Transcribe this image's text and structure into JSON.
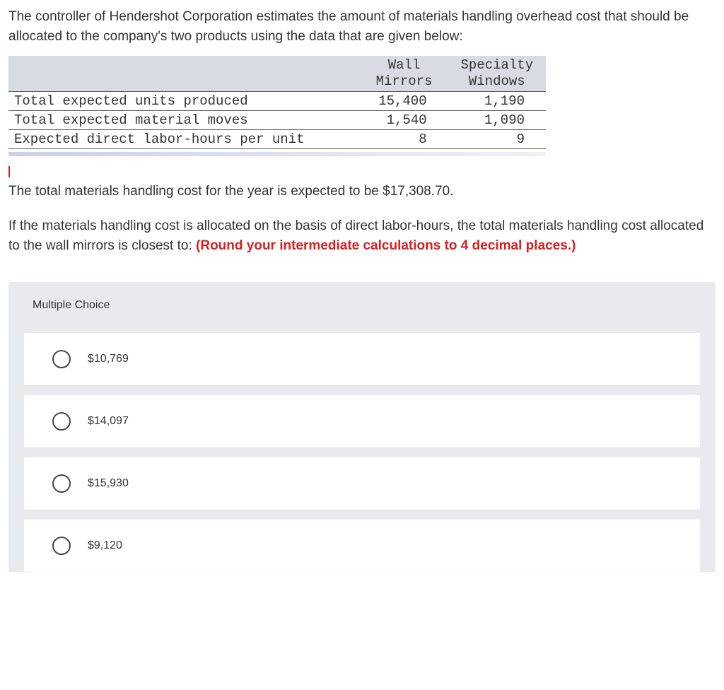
{
  "stem": "The controller of Hendershot Corporation estimates the amount of materials handling overhead cost that should be allocated to the company's two products using the data that are given below:",
  "table": {
    "headers": {
      "col1_line1": "Wall",
      "col1_line2": "Mirrors",
      "col2_line1": "Specialty",
      "col2_line2": "Windows"
    },
    "rows": [
      {
        "label": "Total expected units produced",
        "c1": "15,400",
        "c2": "1,190"
      },
      {
        "label": "Total expected material moves",
        "c1": "1,540",
        "c2": "1,090"
      },
      {
        "label": "Expected direct labor-hours per unit",
        "c1": "8",
        "c2": "9"
      }
    ]
  },
  "mid1": "The total materials handling cost for the year is expected to be $17,308.70.",
  "mid2a": "If the materials handling cost is allocated on the basis of direct labor-hours, the total materials handling cost allocated to the wall mirrors is closest to: ",
  "mid2b": "(Round your intermediate calculations to 4 decimal places.)",
  "mc_heading": "Multiple Choice",
  "options": [
    {
      "label": "$10,769"
    },
    {
      "label": "$14,097"
    },
    {
      "label": "$15,930"
    },
    {
      "label": "$9,120"
    }
  ]
}
